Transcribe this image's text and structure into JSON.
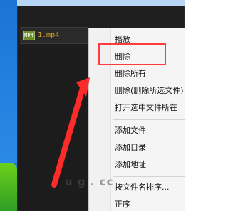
{
  "playlist": {
    "badge": "MP4",
    "file_name": "1.mp4"
  },
  "context_menu": {
    "items": [
      {
        "label": "播放"
      },
      {
        "label": "删除"
      },
      {
        "label": "删除所有"
      },
      {
        "label": "删除(删除所选文件)"
      },
      {
        "label": "打开选中文件所在"
      },
      {
        "label": "添加文件"
      },
      {
        "label": "添加目录"
      },
      {
        "label": "添加地址"
      },
      {
        "label": "按文件名排序..."
      },
      {
        "label": "正序"
      }
    ]
  },
  "watermark": {
    "text": "u  g  .  cc"
  },
  "colors": {
    "accent_red": "#ff3b3b",
    "desktop_blue": "#2f86db",
    "window_dark": "#1f1f1f",
    "menu_bg": "#f5f5f5",
    "file_text": "#d8a820"
  }
}
